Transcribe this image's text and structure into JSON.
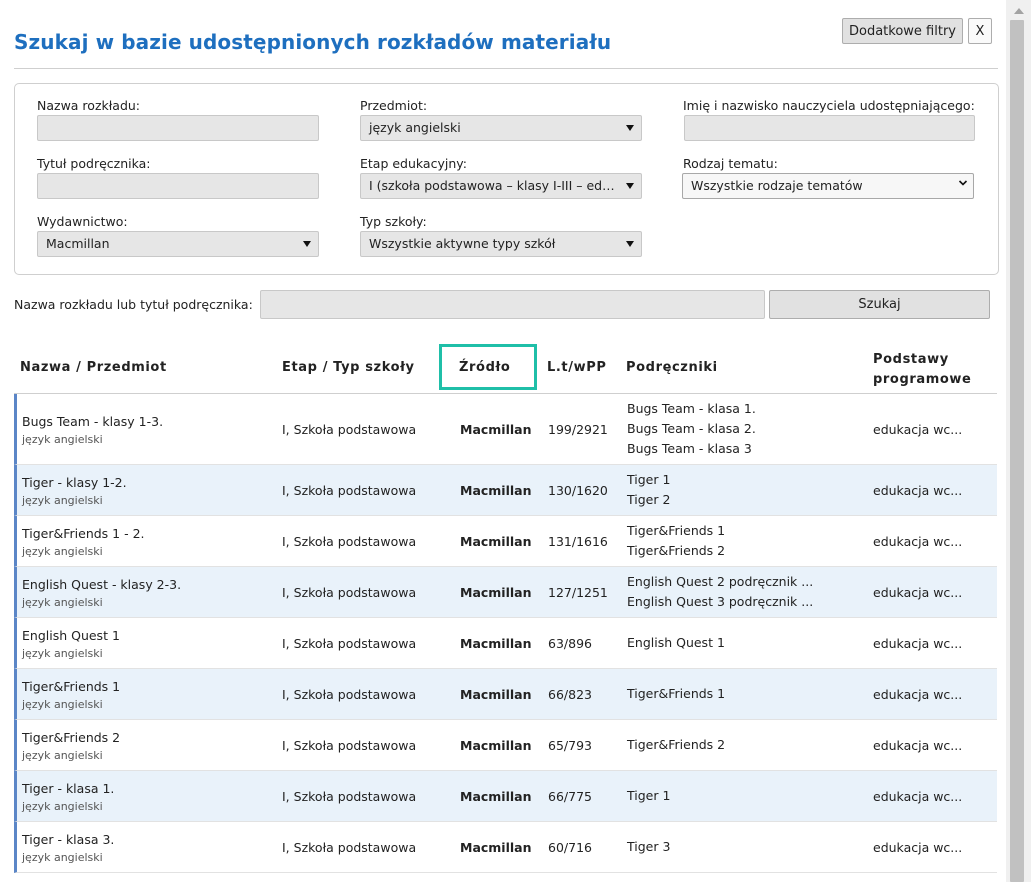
{
  "dialog": {
    "title": "Szukaj w bazie udostępnionych rozkładów materiału",
    "filters_button": "Dodatkowe filtry",
    "close_button": "X"
  },
  "filters": {
    "name_label": "Nazwa rozkładu:",
    "name_value": "",
    "subject_label": "Przedmiot:",
    "subject_value": "język angielski",
    "teacher_label": "Imię i nazwisko nauczyciela udostępniającego:",
    "teacher_value": "",
    "textbook_label": "Tytuł podręcznika:",
    "textbook_value": "",
    "stage_label": "Etap edukacyjny:",
    "stage_value": "I (szkoła podstawowa – klasy I-III – edukacja wczesnoszkolna)",
    "topic_label": "Rodzaj tematu:",
    "topic_value": "Wszystkie rodzaje tematów",
    "publisher_label": "Wydawnictwo:",
    "publisher_value": "Macmillan",
    "school_label": "Typ szkoły:",
    "school_value": "Wszystkie aktywne typy szkół"
  },
  "search": {
    "label": "Nazwa rozkładu lub tytuł podręcznika:",
    "value": "",
    "button": "Szukaj"
  },
  "table": {
    "headers": {
      "name": "Nazwa / Przedmiot",
      "stage": "Etap / Typ szkoły",
      "source": "Źródło",
      "count": "L.t/wPP",
      "books": "Podręczniki",
      "basis_line1": "Podstawy",
      "basis_line2": "programowe"
    },
    "rows": [
      {
        "name": "Bugs Team - klasy 1-3.",
        "subject": "język angielski",
        "stage": "I, Szkoła podstawowa",
        "source": "Macmillan",
        "count": "199/2921",
        "books": [
          "Bugs Team - klasa 1.",
          "Bugs Team - klasa 2.",
          "Bugs Team - klasa 3"
        ],
        "basis": "edukacja wc..."
      },
      {
        "name": "Tiger - klasy 1-2.",
        "subject": "język angielski",
        "stage": "I, Szkoła podstawowa",
        "source": "Macmillan",
        "count": "130/1620",
        "books": [
          "Tiger 1",
          "Tiger 2"
        ],
        "basis": "edukacja wc..."
      },
      {
        "name": "Tiger&Friends 1 - 2.",
        "subject": "język angielski",
        "stage": "I, Szkoła podstawowa",
        "source": "Macmillan",
        "count": "131/1616",
        "books": [
          "Tiger&Friends 1",
          "Tiger&Friends 2"
        ],
        "basis": "edukacja wc..."
      },
      {
        "name": "English Quest - klasy 2-3.",
        "subject": "język angielski",
        "stage": "I, Szkoła podstawowa",
        "source": "Macmillan",
        "count": "127/1251",
        "books": [
          "English Quest 2 podręcznik ...",
          "English Quest 3 podręcznik ..."
        ],
        "basis": "edukacja wc..."
      },
      {
        "name": "English Quest 1",
        "subject": "język angielski",
        "stage": "I, Szkoła podstawowa",
        "source": "Macmillan",
        "count": "63/896",
        "books": [
          "English Quest 1"
        ],
        "basis": "edukacja wc..."
      },
      {
        "name": "Tiger&Friends 1",
        "subject": "język angielski",
        "stage": "I, Szkoła podstawowa",
        "source": "Macmillan",
        "count": "66/823",
        "books": [
          "Tiger&Friends 1"
        ],
        "basis": "edukacja wc..."
      },
      {
        "name": "Tiger&Friends 2",
        "subject": "język angielski",
        "stage": "I, Szkoła podstawowa",
        "source": "Macmillan",
        "count": "65/793",
        "books": [
          "Tiger&Friends 2"
        ],
        "basis": "edukacja wc..."
      },
      {
        "name": "Tiger - klasa 1.",
        "subject": "język angielski",
        "stage": "I, Szkoła podstawowa",
        "source": "Macmillan",
        "count": "66/775",
        "books": [
          "Tiger 1"
        ],
        "basis": "edukacja wc..."
      },
      {
        "name": "Tiger - klasa 3.",
        "subject": "język angielski",
        "stage": "I, Szkoła podstawowa",
        "source": "Macmillan",
        "count": "60/716",
        "books": [
          "Tiger 3"
        ],
        "basis": "edukacja wc..."
      }
    ]
  },
  "colors": {
    "title": "#1e6fbf",
    "highlight": "#1fbfa8",
    "row_alt": "#e9f2fa",
    "row_accent": "#5b86c7"
  }
}
